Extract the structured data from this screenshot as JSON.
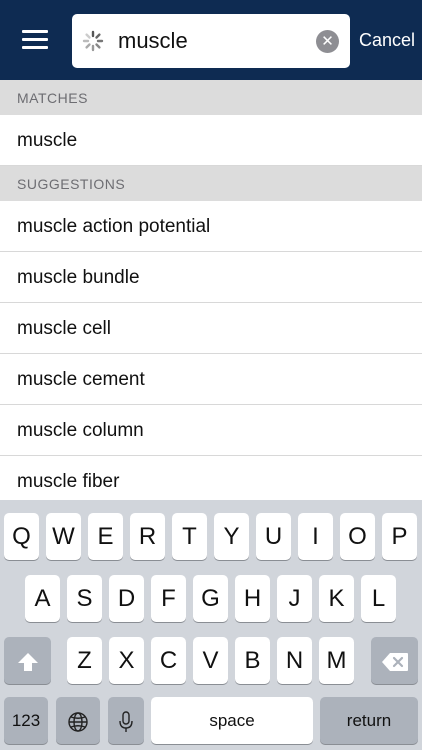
{
  "header": {
    "search_value": "muscle",
    "cancel_label": "Cancel",
    "clear_glyph": "✕"
  },
  "sections": {
    "matches_label": "MATCHES",
    "suggestions_label": "SUGGESTIONS"
  },
  "matches": [
    "muscle"
  ],
  "suggestions": [
    "muscle action potential",
    "muscle bundle",
    "muscle cell",
    "muscle cement",
    "muscle column",
    "muscle fiber"
  ],
  "keyboard": {
    "row1": [
      "Q",
      "W",
      "E",
      "R",
      "T",
      "Y",
      "U",
      "I",
      "O",
      "P"
    ],
    "row2": [
      "A",
      "S",
      "D",
      "F",
      "G",
      "H",
      "J",
      "K",
      "L"
    ],
    "row3": [
      "Z",
      "X",
      "C",
      "V",
      "B",
      "N",
      "M"
    ],
    "numbers_label": "123",
    "space_label": "space",
    "return_label": "return"
  },
  "colors": {
    "header_bg": "#0e2b52",
    "section_bg": "#dcdcdc",
    "keyboard_bg": "#d1d5db"
  }
}
